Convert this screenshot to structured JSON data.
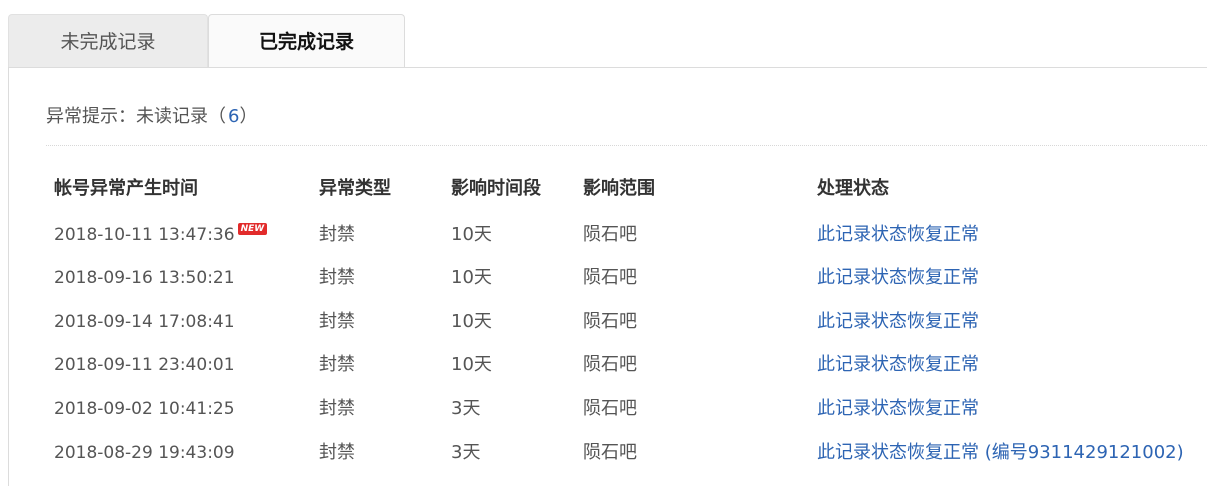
{
  "tabs": [
    {
      "label": "未完成记录"
    },
    {
      "label": "已完成记录"
    }
  ],
  "notice": {
    "prefix": "异常提示：未读记录（",
    "count": "6",
    "suffix": "）"
  },
  "table": {
    "headers": [
      "帐号异常产生时间",
      "异常类型",
      "影响时间段",
      "影响范围",
      "处理状态"
    ],
    "new_badge": "NEW",
    "rows": [
      {
        "time": "2018-10-11 13:47:36",
        "type": "封禁",
        "duration": "10天",
        "scope": "陨石吧",
        "status": "此记录状态恢复正常"
      },
      {
        "time": "2018-09-16 13:50:21",
        "type": "封禁",
        "duration": "10天",
        "scope": "陨石吧",
        "status": "此记录状态恢复正常"
      },
      {
        "time": "2018-09-14 17:08:41",
        "type": "封禁",
        "duration": "10天",
        "scope": "陨石吧",
        "status": "此记录状态恢复正常"
      },
      {
        "time": "2018-09-11 23:40:01",
        "type": "封禁",
        "duration": "10天",
        "scope": "陨石吧",
        "status": "此记录状态恢复正常"
      },
      {
        "time": "2018-09-02 10:41:25",
        "type": "封禁",
        "duration": "3天",
        "scope": "陨石吧",
        "status": "此记录状态恢复正常"
      },
      {
        "time": "2018-08-29 19:43:09",
        "type": "封禁",
        "duration": "3天",
        "scope": "陨石吧",
        "status": "此记录状态恢复正常 (编号9311429121002)"
      }
    ]
  },
  "colors": {
    "link": "#2d64b3",
    "badge": "#e22b2b"
  }
}
